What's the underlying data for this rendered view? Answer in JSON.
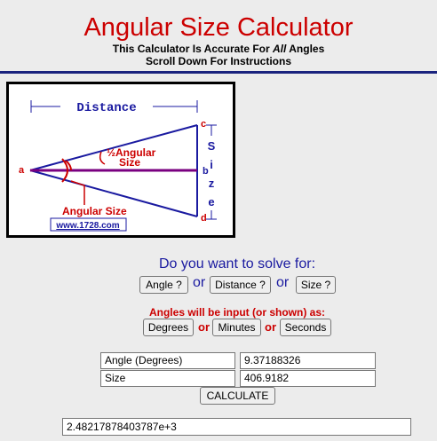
{
  "header": {
    "title": "Angular Size Calculator",
    "subtitle_pre": "This Calculator Is Accurate For ",
    "subtitle_em": "All",
    "subtitle_post": " Angles",
    "subtitle2": "Scroll Down For Instructions"
  },
  "diagram": {
    "distance_label": "Distance",
    "half_angle_label_1": "½Angular",
    "half_angle_label_2": "Size",
    "angular_size_label": "Angular Size",
    "size_label": [
      "S",
      "i",
      "z",
      "e"
    ],
    "point_a": "a",
    "point_b": "b",
    "point_c": "c",
    "point_d": "d",
    "credit": "www.1728.com"
  },
  "solve": {
    "question": "Do you want to solve for:",
    "angle_button": "Angle ?",
    "distance_button": "Distance ?",
    "size_button": "Size ?",
    "or": "or"
  },
  "units": {
    "note": "Angles will be input (or shown) as:",
    "degrees_button": "Degrees",
    "minutes_button": "Minutes",
    "seconds_button": "Seconds",
    "or": "or"
  },
  "form": {
    "row1_label": "Angle (Degrees)",
    "row1_value": "9.37188326",
    "row2_label": "Size",
    "row2_value": "406.9182",
    "calculate_button": "CALCULATE",
    "result_value": "2.48217878403787e+3"
  }
}
